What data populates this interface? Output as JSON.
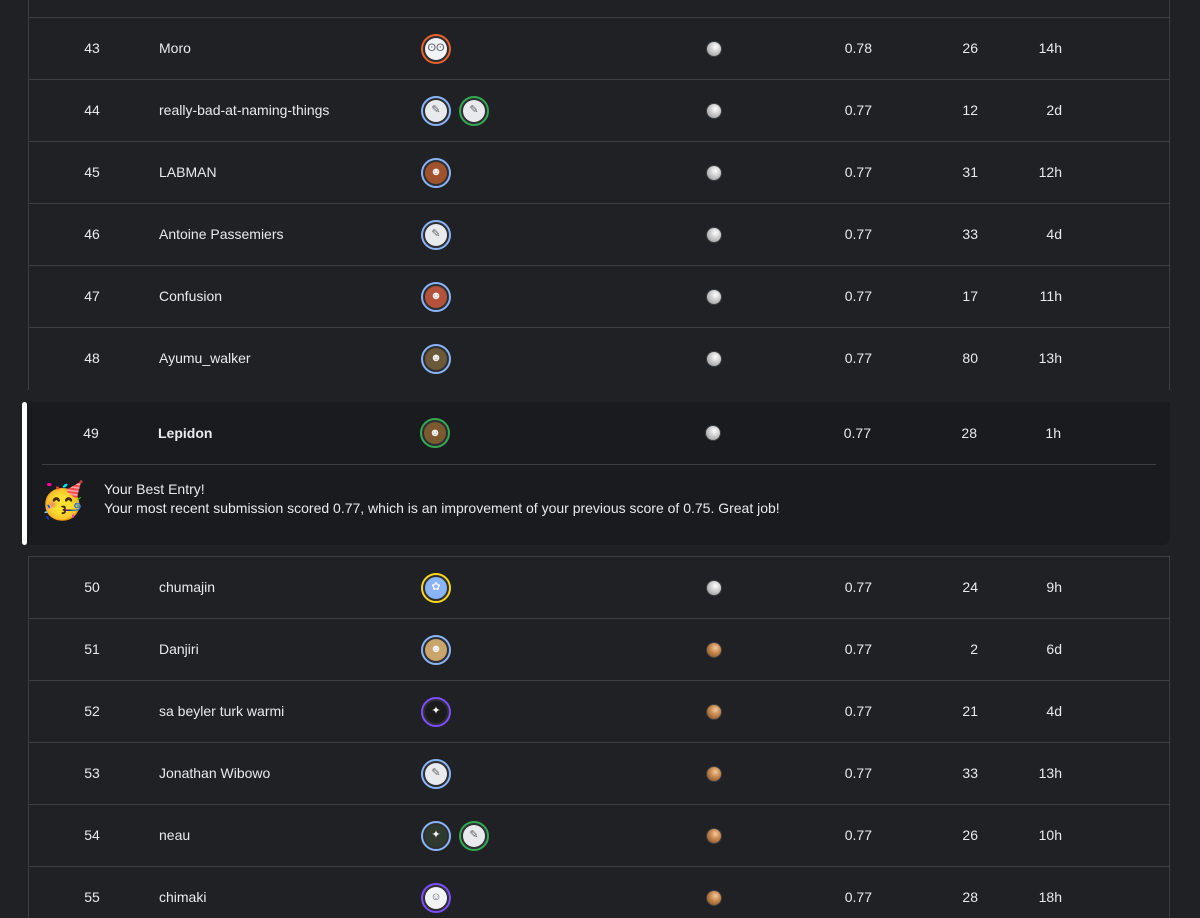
{
  "rows_before": [
    {
      "rank": "43",
      "team_name": "Moro",
      "avatars": [
        {
          "icon": "robot-face",
          "ring": "#e8622c",
          "bg": "#f1f3f4",
          "glyph": "ʘʘ"
        }
      ],
      "medal": "silver",
      "score": "0.78",
      "entries": "26",
      "last": "14h"
    },
    {
      "rank": "44",
      "team_name": "really-bad-at-naming-things",
      "avatars": [
        {
          "icon": "goose-avatar",
          "ring": "#8ab4f8",
          "bg": "#e8eaed",
          "glyph": "✎"
        },
        {
          "icon": "goose-avatar",
          "ring": "#34a853",
          "bg": "#e8eaed",
          "glyph": "✎"
        }
      ],
      "medal": "silver",
      "score": "0.77",
      "entries": "12",
      "last": "2d"
    },
    {
      "rank": "45",
      "team_name": "LABMAN",
      "avatars": [
        {
          "icon": "person-photo",
          "ring": "#8ab4f8",
          "bg": "#a0522d",
          "glyph": "☻"
        }
      ],
      "medal": "silver",
      "score": "0.77",
      "entries": "31",
      "last": "12h"
    },
    {
      "rank": "46",
      "team_name": "Antoine Passemiers",
      "avatars": [
        {
          "icon": "goose-avatar",
          "ring": "#8ab4f8",
          "bg": "#e8eaed",
          "glyph": "✎"
        }
      ],
      "medal": "silver",
      "score": "0.77",
      "entries": "33",
      "last": "4d"
    },
    {
      "rank": "47",
      "team_name": "Confusion",
      "avatars": [
        {
          "icon": "person-photo",
          "ring": "#8ab4f8",
          "bg": "#b5523b",
          "glyph": "☻"
        }
      ],
      "medal": "silver",
      "score": "0.77",
      "entries": "17",
      "last": "11h"
    },
    {
      "rank": "48",
      "team_name": "Ayumu_walker",
      "avatars": [
        {
          "icon": "person-photo",
          "ring": "#8ab4f8",
          "bg": "#6b5a3a",
          "glyph": "☻"
        }
      ],
      "medal": "silver",
      "score": "0.77",
      "entries": "80",
      "last": "13h"
    }
  ],
  "highlight": {
    "rank": "49",
    "team_name": "Lepidon",
    "avatars": [
      {
        "icon": "person-photo",
        "ring": "#34a853",
        "bg": "#7a5a2e",
        "glyph": "☻"
      }
    ],
    "medal": "silver",
    "score": "0.77",
    "entries": "28",
    "last": "1h",
    "note_emoji": "🥳",
    "note_title": "Your Best Entry!",
    "note_text": "Your most recent submission scored 0.77, which is an improvement of your previous score of 0.75. Great job!"
  },
  "rows_after": [
    {
      "rank": "50",
      "team_name": "chumajin",
      "avatars": [
        {
          "icon": "flower-avatar",
          "ring": "#f9d71c",
          "bg": "#8ab4f8",
          "glyph": "✿"
        }
      ],
      "medal": "silver",
      "score": "0.77",
      "entries": "24",
      "last": "9h"
    },
    {
      "rank": "51",
      "team_name": "Danjiri",
      "avatars": [
        {
          "icon": "person-photo",
          "ring": "#8ab4f8",
          "bg": "#c9a46b",
          "glyph": "☻"
        }
      ],
      "medal": "bronze",
      "score": "0.77",
      "entries": "2",
      "last": "6d"
    },
    {
      "rank": "52",
      "team_name": "sa beyler turk warmi",
      "avatars": [
        {
          "icon": "dark-character",
          "ring": "#7c4dff",
          "bg": "#1b1b1b",
          "glyph": "✦"
        }
      ],
      "medal": "bronze",
      "score": "0.77",
      "entries": "21",
      "last": "4d"
    },
    {
      "rank": "53",
      "team_name": "Jonathan Wibowo",
      "avatars": [
        {
          "icon": "goose-avatar",
          "ring": "#8ab4f8",
          "bg": "#e8eaed",
          "glyph": "✎"
        }
      ],
      "medal": "bronze",
      "score": "0.77",
      "entries": "33",
      "last": "13h"
    },
    {
      "rank": "54",
      "team_name": "neau",
      "avatars": [
        {
          "icon": "dark-character",
          "ring": "#8ab4f8",
          "bg": "#2f3b2f",
          "glyph": "✦"
        },
        {
          "icon": "goose-avatar",
          "ring": "#34a853",
          "bg": "#e8eaed",
          "glyph": "✎"
        }
      ],
      "medal": "bronze",
      "score": "0.77",
      "entries": "26",
      "last": "10h"
    },
    {
      "rank": "55",
      "team_name": "chimaki",
      "avatars": [
        {
          "icon": "character-avatar",
          "ring": "#7c4dff",
          "bg": "#f1f3f4",
          "glyph": "☺"
        }
      ],
      "medal": "bronze",
      "score": "0.77",
      "entries": "28",
      "last": "18h"
    }
  ]
}
